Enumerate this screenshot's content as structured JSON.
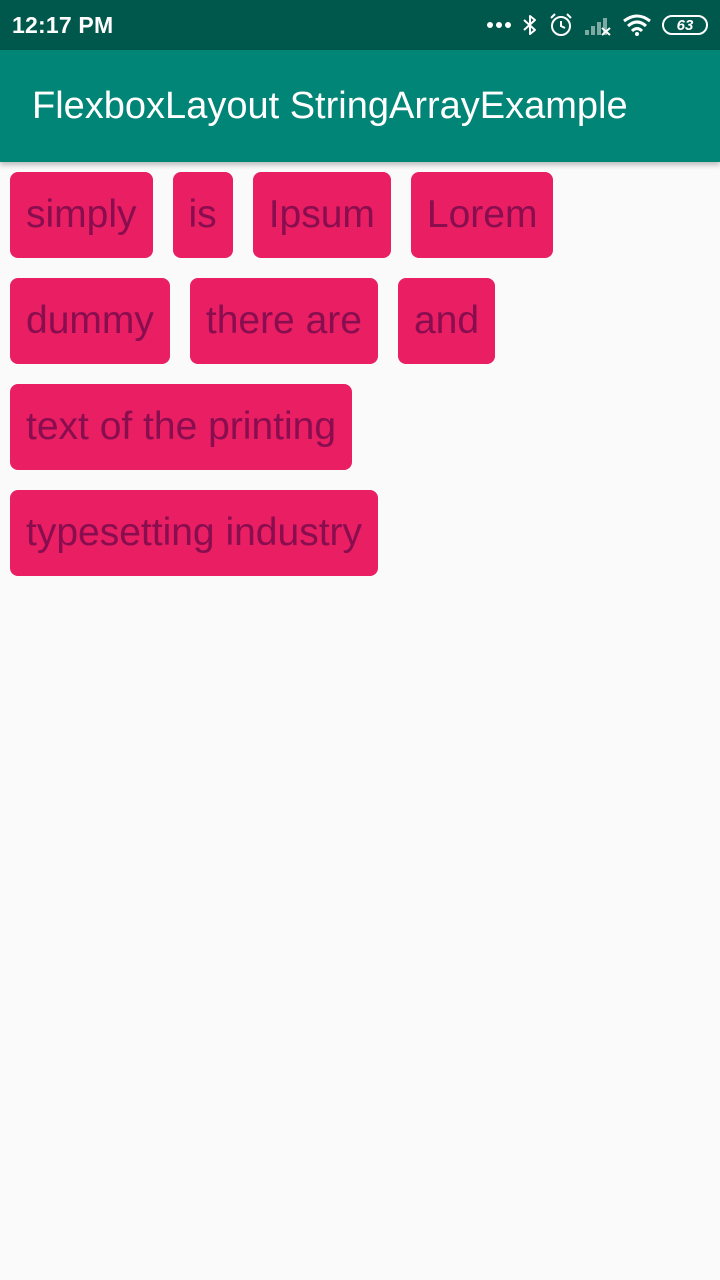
{
  "status_bar": {
    "time": "12:17 PM",
    "battery_level": "63",
    "icons": [
      "more-dots-icon",
      "bluetooth-icon",
      "alarm-icon",
      "signal-icon",
      "wifi-icon",
      "battery-icon"
    ]
  },
  "app_bar": {
    "title": "FlexboxLayout StringArrayExample",
    "color": "#008577",
    "status_color": "#00574b"
  },
  "flexbox": {
    "item_color": "#e91e63",
    "item_text_color": "#880e4f",
    "items": [
      "simply",
      "is",
      "Ipsum",
      "Lorem",
      "dummy",
      "there are",
      "and",
      "text of the printing",
      "typesetting industry"
    ]
  }
}
